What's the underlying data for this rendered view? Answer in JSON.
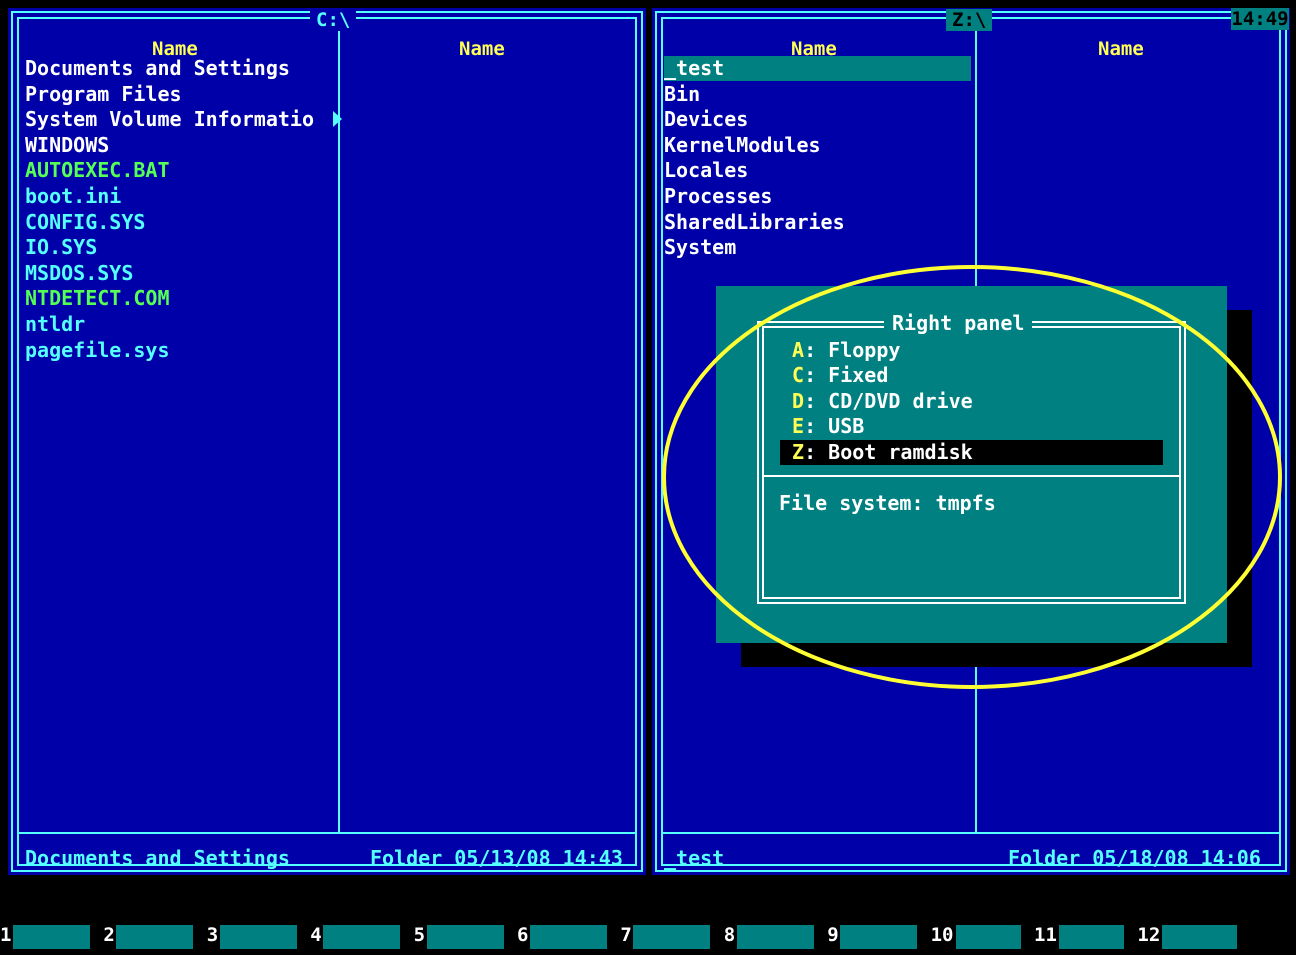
{
  "clock": "14:49",
  "left_panel": {
    "path": "C:\\",
    "col_header_1": "Name",
    "col_header_2": "Name",
    "files": [
      {
        "name": "Documents and Settings",
        "color": "white"
      },
      {
        "name": "Program Files",
        "color": "white"
      },
      {
        "name": "System Volume Informatio",
        "color": "white"
      },
      {
        "name": "WINDOWS",
        "color": "white"
      },
      {
        "name": "AUTOEXEC.BAT",
        "color": "green"
      },
      {
        "name": "boot.ini",
        "color": "cyan"
      },
      {
        "name": "CONFIG.SYS",
        "color": "cyan"
      },
      {
        "name": "IO.SYS",
        "color": "cyan"
      },
      {
        "name": "MSDOS.SYS",
        "color": "cyan"
      },
      {
        "name": "NTDETECT.COM",
        "color": "green"
      },
      {
        "name": "ntldr",
        "color": "cyan"
      },
      {
        "name": "pagefile.sys",
        "color": "cyan"
      }
    ],
    "status_name": "Documents and Settings",
    "status_info": "Folder 05/13/08 14:43"
  },
  "right_panel": {
    "path": "Z:\\",
    "col_header_1": "Name",
    "col_header_2": "Name",
    "files": [
      {
        "name": "_test",
        "color": "white",
        "selected": true
      },
      {
        "name": "Bin",
        "color": "white"
      },
      {
        "name": "Devices",
        "color": "white"
      },
      {
        "name": "KernelModules",
        "color": "white"
      },
      {
        "name": "Locales",
        "color": "white"
      },
      {
        "name": "Processes",
        "color": "white"
      },
      {
        "name": "SharedLibraries",
        "color": "white"
      },
      {
        "name": "System",
        "color": "white"
      }
    ],
    "status_name": "_test",
    "status_info": "Folder 05/18/08 14:06"
  },
  "drive_dialog": {
    "title": "Right panel",
    "drives": [
      {
        "letter": "A",
        "label": "Floppy"
      },
      {
        "letter": "C",
        "label": "Fixed"
      },
      {
        "letter": "D",
        "label": "CD/DVD drive"
      },
      {
        "letter": "E",
        "label": "USB"
      },
      {
        "letter": "Z",
        "label": "Boot ramdisk",
        "selected": true
      }
    ],
    "info": "File system: tmpfs"
  },
  "function_keys": [
    "1",
    "2",
    "3",
    "4",
    "5",
    "6",
    "7",
    "8",
    "9",
    "10",
    "11",
    "12"
  ],
  "colors": {
    "panel_bg": "#0000a8",
    "frame": "#55ffff",
    "header": "#ffff55",
    "dialog_bg": "#008080",
    "highlight_ellipse": "#ffff33"
  }
}
